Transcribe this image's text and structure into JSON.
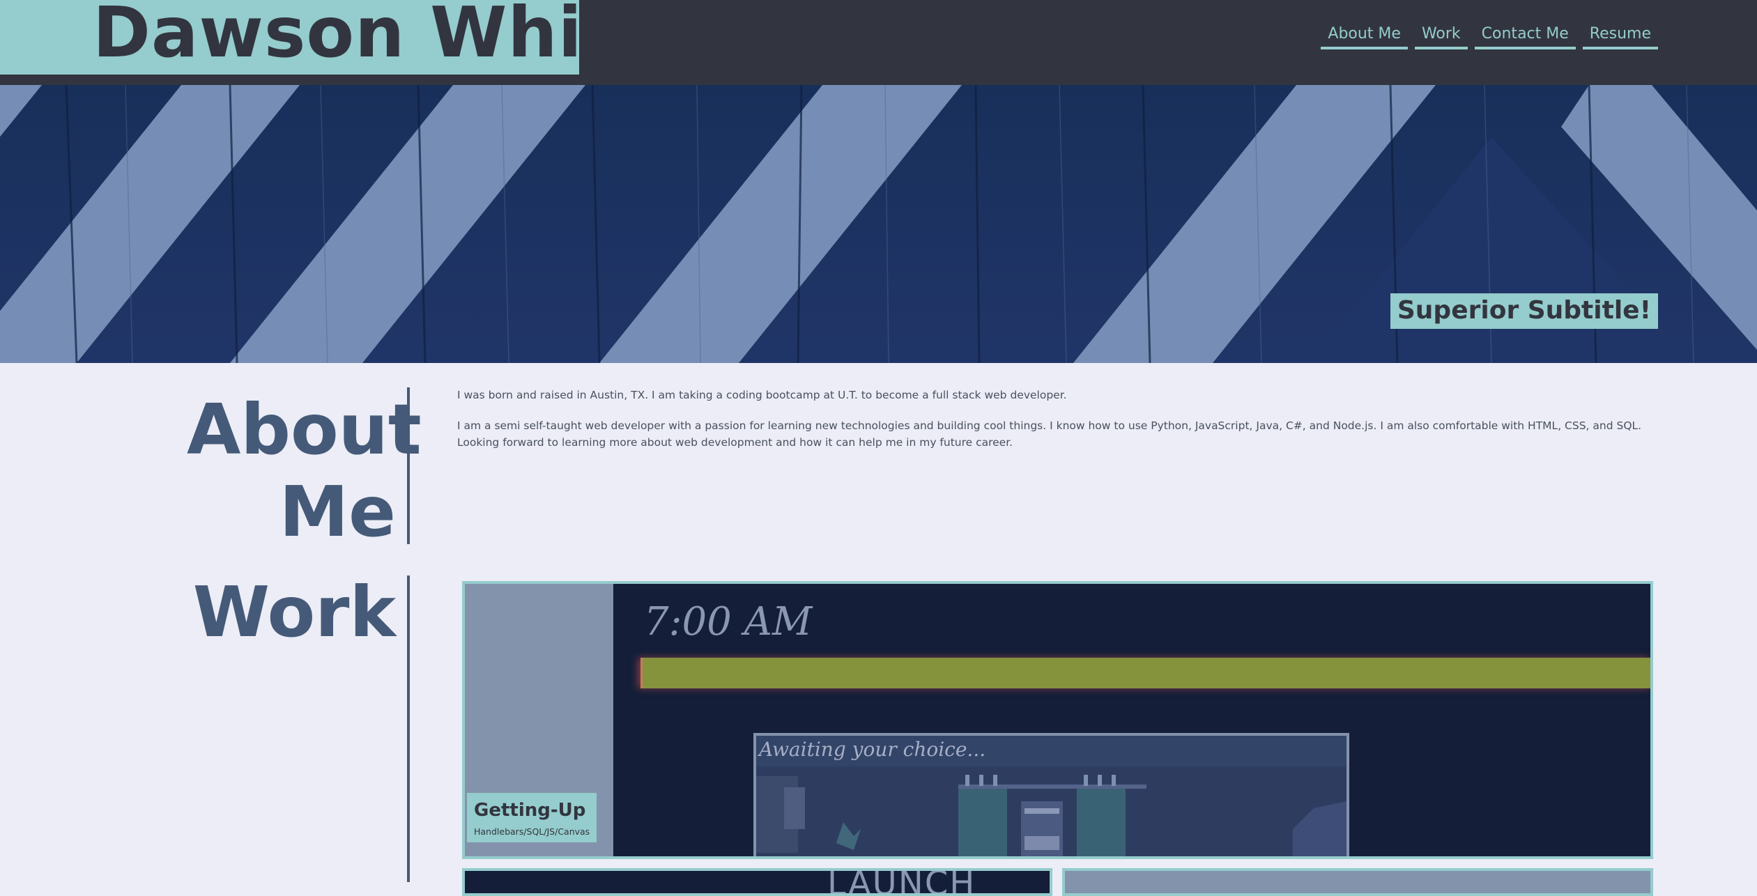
{
  "header": {
    "brand": "Dawson White",
    "nav": [
      "About Me",
      "Work",
      "Contact Me",
      "Resume"
    ]
  },
  "hero": {
    "subtitle": "Superior Subtitle!"
  },
  "about": {
    "title": "About Me",
    "paragraphs": [
      "I was born and raised in Austin, TX. I am taking a coding bootcamp at U.T. to become a full stack web developer.",
      "I am a semi self-taught web developer with a passion for learning new technologies and building cool things. I know how to use Python, JavaScript, Java, C#, and Node.js. I am also comfortable with HTML, CSS, and SQL. Looking forward to learning more about web development and how it can help me in my future career."
    ]
  },
  "work": {
    "title": "Work",
    "projects": [
      {
        "title": "Getting-Up",
        "tech": "Handlebars/SQL/JS/Canvas",
        "preview": {
          "clock": "7:00 AM",
          "prompt": "Awaiting your choice..."
        }
      },
      {
        "preview_text": "LAUNCH"
      }
    ]
  },
  "colors": {
    "accent": "#95cccd",
    "dark": "#32353f",
    "heading": "#455a78",
    "background": "#ecedf6"
  }
}
